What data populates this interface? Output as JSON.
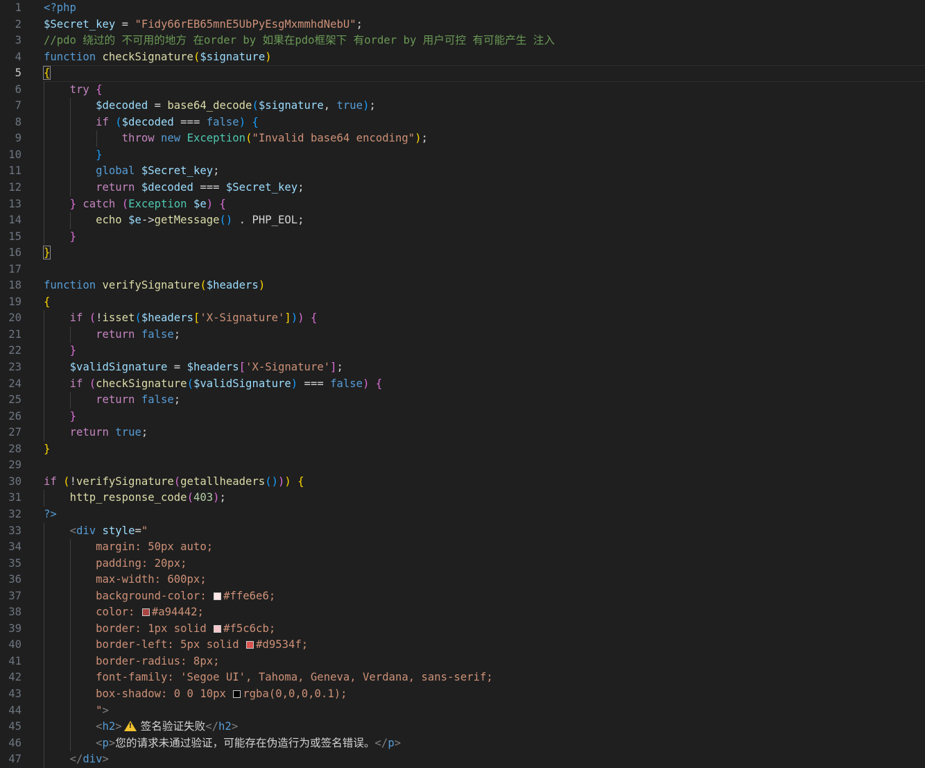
{
  "colors": {
    "background": "#1f1f1f",
    "line_number": "#6e7681",
    "keyword": "#569cd6",
    "control": "#c586c0",
    "function": "#dcdcaa",
    "variable": "#9cdcfe",
    "string": "#ce9178",
    "comment": "#6a9955",
    "number": "#b5cea8",
    "class": "#4ec9b0",
    "tag": "#808080"
  },
  "current_line": 5,
  "lines": [
    {
      "n": 1,
      "indent": 0,
      "tokens": [
        {
          "t": "<?php",
          "c": "#569cd6"
        }
      ]
    },
    {
      "n": 2,
      "indent": 0,
      "tokens": [
        {
          "t": "$Secret_key",
          "c": "#9cdcfe"
        },
        {
          "t": " = ",
          "c": "#d4d4d4"
        },
        {
          "t": "\"Fidy66rEB65mnE5UbPyEsgMxmmhdNebU\"",
          "c": "#ce9178"
        },
        {
          "t": ";",
          "c": "#d4d4d4"
        }
      ]
    },
    {
      "n": 3,
      "indent": 0,
      "tokens": [
        {
          "t": "//pdo 绕过的 不可用的地方 在order by 如果在pdo框架下 有order by 用户可控 有可能产生 注入",
          "c": "#6a9955"
        }
      ]
    },
    {
      "n": 4,
      "indent": 0,
      "tokens": [
        {
          "t": "function",
          "c": "#569cd6"
        },
        {
          "t": " ",
          "c": "#d4d4d4"
        },
        {
          "t": "checkSignature",
          "c": "#dcdcaa"
        },
        {
          "t": "(",
          "c": "#ffd700"
        },
        {
          "t": "$signature",
          "c": "#9cdcfe"
        },
        {
          "t": ")",
          "c": "#ffd700"
        }
      ]
    },
    {
      "n": 5,
      "indent": 0,
      "tokens": [
        {
          "t": "{",
          "c": "#ffd700",
          "bm": true
        }
      ]
    },
    {
      "n": 6,
      "indent": 1,
      "tokens": [
        {
          "t": "    ",
          "c": "#d4d4d4"
        },
        {
          "t": "try",
          "c": "#c586c0"
        },
        {
          "t": " ",
          "c": "#d4d4d4"
        },
        {
          "t": "{",
          "c": "#da70d6"
        }
      ]
    },
    {
      "n": 7,
      "indent": 2,
      "tokens": [
        {
          "t": "        ",
          "c": "#d4d4d4"
        },
        {
          "t": "$decoded",
          "c": "#9cdcfe"
        },
        {
          "t": " = ",
          "c": "#d4d4d4"
        },
        {
          "t": "base64_decode",
          "c": "#dcdcaa"
        },
        {
          "t": "(",
          "c": "#179fff"
        },
        {
          "t": "$signature",
          "c": "#9cdcfe"
        },
        {
          "t": ", ",
          "c": "#d4d4d4"
        },
        {
          "t": "true",
          "c": "#569cd6"
        },
        {
          "t": ")",
          "c": "#179fff"
        },
        {
          "t": ";",
          "c": "#d4d4d4"
        }
      ]
    },
    {
      "n": 8,
      "indent": 2,
      "tokens": [
        {
          "t": "        ",
          "c": "#d4d4d4"
        },
        {
          "t": "if",
          "c": "#c586c0"
        },
        {
          "t": " ",
          "c": "#d4d4d4"
        },
        {
          "t": "(",
          "c": "#179fff"
        },
        {
          "t": "$decoded",
          "c": "#9cdcfe"
        },
        {
          "t": " === ",
          "c": "#d4d4d4"
        },
        {
          "t": "false",
          "c": "#569cd6"
        },
        {
          "t": ")",
          "c": "#179fff"
        },
        {
          "t": " ",
          "c": "#d4d4d4"
        },
        {
          "t": "{",
          "c": "#179fff"
        }
      ]
    },
    {
      "n": 9,
      "indent": 3,
      "tokens": [
        {
          "t": "            ",
          "c": "#d4d4d4"
        },
        {
          "t": "throw",
          "c": "#c586c0"
        },
        {
          "t": " ",
          "c": "#d4d4d4"
        },
        {
          "t": "new",
          "c": "#569cd6"
        },
        {
          "t": " ",
          "c": "#d4d4d4"
        },
        {
          "t": "Exception",
          "c": "#4ec9b0"
        },
        {
          "t": "(",
          "c": "#ffd700"
        },
        {
          "t": "\"Invalid base64 encoding\"",
          "c": "#ce9178"
        },
        {
          "t": ")",
          "c": "#ffd700"
        },
        {
          "t": ";",
          "c": "#d4d4d4"
        }
      ]
    },
    {
      "n": 10,
      "indent": 2,
      "tokens": [
        {
          "t": "        ",
          "c": "#d4d4d4"
        },
        {
          "t": "}",
          "c": "#179fff"
        }
      ]
    },
    {
      "n": 11,
      "indent": 2,
      "tokens": [
        {
          "t": "        ",
          "c": "#d4d4d4"
        },
        {
          "t": "global",
          "c": "#569cd6"
        },
        {
          "t": " ",
          "c": "#d4d4d4"
        },
        {
          "t": "$Secret_key",
          "c": "#9cdcfe"
        },
        {
          "t": ";",
          "c": "#d4d4d4"
        }
      ]
    },
    {
      "n": 12,
      "indent": 2,
      "tokens": [
        {
          "t": "        ",
          "c": "#d4d4d4"
        },
        {
          "t": "return",
          "c": "#c586c0"
        },
        {
          "t": " ",
          "c": "#d4d4d4"
        },
        {
          "t": "$decoded",
          "c": "#9cdcfe"
        },
        {
          "t": " === ",
          "c": "#d4d4d4"
        },
        {
          "t": "$Secret_key",
          "c": "#9cdcfe"
        },
        {
          "t": ";",
          "c": "#d4d4d4"
        }
      ]
    },
    {
      "n": 13,
      "indent": 1,
      "tokens": [
        {
          "t": "    ",
          "c": "#d4d4d4"
        },
        {
          "t": "}",
          "c": "#da70d6"
        },
        {
          "t": " ",
          "c": "#d4d4d4"
        },
        {
          "t": "catch",
          "c": "#c586c0"
        },
        {
          "t": " ",
          "c": "#d4d4d4"
        },
        {
          "t": "(",
          "c": "#da70d6"
        },
        {
          "t": "Exception",
          "c": "#4ec9b0"
        },
        {
          "t": " ",
          "c": "#d4d4d4"
        },
        {
          "t": "$e",
          "c": "#9cdcfe"
        },
        {
          "t": ")",
          "c": "#da70d6"
        },
        {
          "t": " ",
          "c": "#d4d4d4"
        },
        {
          "t": "{",
          "c": "#da70d6"
        }
      ]
    },
    {
      "n": 14,
      "indent": 2,
      "tokens": [
        {
          "t": "        ",
          "c": "#d4d4d4"
        },
        {
          "t": "echo",
          "c": "#dcdcaa"
        },
        {
          "t": " ",
          "c": "#d4d4d4"
        },
        {
          "t": "$e",
          "c": "#9cdcfe"
        },
        {
          "t": "->",
          "c": "#d4d4d4"
        },
        {
          "t": "getMessage",
          "c": "#dcdcaa"
        },
        {
          "t": "()",
          "c": "#179fff"
        },
        {
          "t": " . PHP_EOL;",
          "c": "#d4d4d4"
        }
      ]
    },
    {
      "n": 15,
      "indent": 1,
      "tokens": [
        {
          "t": "    ",
          "c": "#d4d4d4"
        },
        {
          "t": "}",
          "c": "#da70d6"
        }
      ]
    },
    {
      "n": 16,
      "indent": 0,
      "tokens": [
        {
          "t": "}",
          "c": "#ffd700",
          "bm": true
        }
      ]
    },
    {
      "n": 17,
      "indent": 0,
      "tokens": []
    },
    {
      "n": 18,
      "indent": 0,
      "tokens": [
        {
          "t": "function",
          "c": "#569cd6"
        },
        {
          "t": " ",
          "c": "#d4d4d4"
        },
        {
          "t": "verifySignature",
          "c": "#dcdcaa"
        },
        {
          "t": "(",
          "c": "#ffd700"
        },
        {
          "t": "$headers",
          "c": "#9cdcfe"
        },
        {
          "t": ")",
          "c": "#ffd700"
        }
      ]
    },
    {
      "n": 19,
      "indent": 0,
      "tokens": [
        {
          "t": "{",
          "c": "#ffd700"
        }
      ]
    },
    {
      "n": 20,
      "indent": 1,
      "tokens": [
        {
          "t": "    ",
          "c": "#d4d4d4"
        },
        {
          "t": "if",
          "c": "#c586c0"
        },
        {
          "t": " ",
          "c": "#d4d4d4"
        },
        {
          "t": "(",
          "c": "#da70d6"
        },
        {
          "t": "!",
          "c": "#d4d4d4"
        },
        {
          "t": "isset",
          "c": "#dcdcaa"
        },
        {
          "t": "(",
          "c": "#179fff"
        },
        {
          "t": "$headers",
          "c": "#9cdcfe"
        },
        {
          "t": "[",
          "c": "#ffd700"
        },
        {
          "t": "'X-Signature'",
          "c": "#ce9178"
        },
        {
          "t": "]",
          "c": "#ffd700"
        },
        {
          "t": ")",
          "c": "#179fff"
        },
        {
          "t": ")",
          "c": "#da70d6"
        },
        {
          "t": " ",
          "c": "#d4d4d4"
        },
        {
          "t": "{",
          "c": "#da70d6"
        }
      ]
    },
    {
      "n": 21,
      "indent": 2,
      "tokens": [
        {
          "t": "        ",
          "c": "#d4d4d4"
        },
        {
          "t": "return",
          "c": "#c586c0"
        },
        {
          "t": " ",
          "c": "#d4d4d4"
        },
        {
          "t": "false",
          "c": "#569cd6"
        },
        {
          "t": ";",
          "c": "#d4d4d4"
        }
      ]
    },
    {
      "n": 22,
      "indent": 1,
      "tokens": [
        {
          "t": "    ",
          "c": "#d4d4d4"
        },
        {
          "t": "}",
          "c": "#da70d6"
        }
      ]
    },
    {
      "n": 23,
      "indent": 1,
      "tokens": [
        {
          "t": "    ",
          "c": "#d4d4d4"
        },
        {
          "t": "$validSignature",
          "c": "#9cdcfe"
        },
        {
          "t": " = ",
          "c": "#d4d4d4"
        },
        {
          "t": "$headers",
          "c": "#9cdcfe"
        },
        {
          "t": "[",
          "c": "#da70d6"
        },
        {
          "t": "'X-Signature'",
          "c": "#ce9178"
        },
        {
          "t": "]",
          "c": "#da70d6"
        },
        {
          "t": ";",
          "c": "#d4d4d4"
        }
      ]
    },
    {
      "n": 24,
      "indent": 1,
      "tokens": [
        {
          "t": "    ",
          "c": "#d4d4d4"
        },
        {
          "t": "if",
          "c": "#c586c0"
        },
        {
          "t": " ",
          "c": "#d4d4d4"
        },
        {
          "t": "(",
          "c": "#da70d6"
        },
        {
          "t": "checkSignature",
          "c": "#dcdcaa"
        },
        {
          "t": "(",
          "c": "#179fff"
        },
        {
          "t": "$validSignature",
          "c": "#9cdcfe"
        },
        {
          "t": ")",
          "c": "#179fff"
        },
        {
          "t": " === ",
          "c": "#d4d4d4"
        },
        {
          "t": "false",
          "c": "#569cd6"
        },
        {
          "t": ")",
          "c": "#da70d6"
        },
        {
          "t": " ",
          "c": "#d4d4d4"
        },
        {
          "t": "{",
          "c": "#da70d6"
        }
      ]
    },
    {
      "n": 25,
      "indent": 2,
      "tokens": [
        {
          "t": "        ",
          "c": "#d4d4d4"
        },
        {
          "t": "return",
          "c": "#c586c0"
        },
        {
          "t": " ",
          "c": "#d4d4d4"
        },
        {
          "t": "false",
          "c": "#569cd6"
        },
        {
          "t": ";",
          "c": "#d4d4d4"
        }
      ]
    },
    {
      "n": 26,
      "indent": 1,
      "tokens": [
        {
          "t": "    ",
          "c": "#d4d4d4"
        },
        {
          "t": "}",
          "c": "#da70d6"
        }
      ]
    },
    {
      "n": 27,
      "indent": 1,
      "tokens": [
        {
          "t": "    ",
          "c": "#d4d4d4"
        },
        {
          "t": "return",
          "c": "#c586c0"
        },
        {
          "t": " ",
          "c": "#d4d4d4"
        },
        {
          "t": "true",
          "c": "#569cd6"
        },
        {
          "t": ";",
          "c": "#d4d4d4"
        }
      ]
    },
    {
      "n": 28,
      "indent": 0,
      "tokens": [
        {
          "t": "}",
          "c": "#ffd700"
        }
      ]
    },
    {
      "n": 29,
      "indent": 0,
      "tokens": []
    },
    {
      "n": 30,
      "indent": 0,
      "tokens": [
        {
          "t": "if",
          "c": "#c586c0"
        },
        {
          "t": " ",
          "c": "#d4d4d4"
        },
        {
          "t": "(",
          "c": "#ffd700"
        },
        {
          "t": "!",
          "c": "#d4d4d4"
        },
        {
          "t": "verifySignature",
          "c": "#dcdcaa"
        },
        {
          "t": "(",
          "c": "#da70d6"
        },
        {
          "t": "getallheaders",
          "c": "#dcdcaa"
        },
        {
          "t": "()",
          "c": "#179fff"
        },
        {
          "t": ")",
          "c": "#da70d6"
        },
        {
          "t": ")",
          "c": "#ffd700"
        },
        {
          "t": " ",
          "c": "#d4d4d4"
        },
        {
          "t": "{",
          "c": "#ffd700"
        }
      ]
    },
    {
      "n": 31,
      "indent": 1,
      "tokens": [
        {
          "t": "    ",
          "c": "#d4d4d4"
        },
        {
          "t": "http_response_code",
          "c": "#dcdcaa"
        },
        {
          "t": "(",
          "c": "#da70d6"
        },
        {
          "t": "403",
          "c": "#b5cea8"
        },
        {
          "t": ")",
          "c": "#da70d6"
        },
        {
          "t": ";",
          "c": "#d4d4d4"
        }
      ]
    },
    {
      "n": 32,
      "indent": 0,
      "tokens": [
        {
          "t": "?>",
          "c": "#569cd6"
        }
      ]
    },
    {
      "n": 33,
      "indent": 1,
      "tokens": [
        {
          "t": "    ",
          "c": "#d4d4d4"
        },
        {
          "t": "<",
          "c": "#808080"
        },
        {
          "t": "div",
          "c": "#569cd6"
        },
        {
          "t": " ",
          "c": "#d4d4d4"
        },
        {
          "t": "style",
          "c": "#9cdcfe"
        },
        {
          "t": "=",
          "c": "#d4d4d4"
        },
        {
          "t": "\"",
          "c": "#ce9178"
        }
      ]
    },
    {
      "n": 34,
      "indent": 2,
      "tokens": [
        {
          "t": "        ",
          "c": "#d4d4d4"
        },
        {
          "t": "margin: 50px auto;",
          "c": "#ce9178"
        }
      ]
    },
    {
      "n": 35,
      "indent": 2,
      "tokens": [
        {
          "t": "        ",
          "c": "#d4d4d4"
        },
        {
          "t": "padding: 20px;",
          "c": "#ce9178"
        }
      ]
    },
    {
      "n": 36,
      "indent": 2,
      "tokens": [
        {
          "t": "        ",
          "c": "#d4d4d4"
        },
        {
          "t": "max-width: 600px;",
          "c": "#ce9178"
        }
      ]
    },
    {
      "n": 37,
      "indent": 2,
      "tokens": [
        {
          "t": "        ",
          "c": "#d4d4d4"
        },
        {
          "t": "background-color: ",
          "c": "#ce9178"
        },
        {
          "sw": "#ffe6e6"
        },
        {
          "t": "#ffe6e6;",
          "c": "#ce9178"
        }
      ]
    },
    {
      "n": 38,
      "indent": 2,
      "tokens": [
        {
          "t": "        ",
          "c": "#d4d4d4"
        },
        {
          "t": "color: ",
          "c": "#ce9178"
        },
        {
          "sw": "#a94442"
        },
        {
          "t": "#a94442;",
          "c": "#ce9178"
        }
      ]
    },
    {
      "n": 39,
      "indent": 2,
      "tokens": [
        {
          "t": "        ",
          "c": "#d4d4d4"
        },
        {
          "t": "border: 1px solid ",
          "c": "#ce9178"
        },
        {
          "sw": "#f5c6cb"
        },
        {
          "t": "#f5c6cb;",
          "c": "#ce9178"
        }
      ]
    },
    {
      "n": 40,
      "indent": 2,
      "tokens": [
        {
          "t": "        ",
          "c": "#d4d4d4"
        },
        {
          "t": "border-left: 5px solid ",
          "c": "#ce9178"
        },
        {
          "sw": "#d9534f"
        },
        {
          "t": "#d9534f;",
          "c": "#ce9178"
        }
      ]
    },
    {
      "n": 41,
      "indent": 2,
      "tokens": [
        {
          "t": "        ",
          "c": "#d4d4d4"
        },
        {
          "t": "border-radius: 8px;",
          "c": "#ce9178"
        }
      ]
    },
    {
      "n": 42,
      "indent": 2,
      "tokens": [
        {
          "t": "        ",
          "c": "#d4d4d4"
        },
        {
          "t": "font-family: 'Segoe UI', Tahoma, Geneva, Verdana, sans-serif;",
          "c": "#ce9178"
        }
      ]
    },
    {
      "n": 43,
      "indent": 2,
      "tokens": [
        {
          "t": "        ",
          "c": "#d4d4d4"
        },
        {
          "t": "box-shadow: 0 0 10px ",
          "c": "#ce9178"
        },
        {
          "sw": "#000000"
        },
        {
          "t": "rgba(0,0,0,0.1);",
          "c": "#ce9178"
        }
      ]
    },
    {
      "n": 44,
      "indent": 2,
      "tokens": [
        {
          "t": "        ",
          "c": "#d4d4d4"
        },
        {
          "t": "\"",
          "c": "#ce9178"
        },
        {
          "t": ">",
          "c": "#808080"
        }
      ]
    },
    {
      "n": 45,
      "indent": 2,
      "tokens": [
        {
          "t": "        ",
          "c": "#d4d4d4"
        },
        {
          "t": "<",
          "c": "#808080"
        },
        {
          "t": "h2",
          "c": "#569cd6"
        },
        {
          "t": ">",
          "c": "#808080"
        },
        {
          "warn": true
        },
        {
          "t": "签名验证失败",
          "c": "#d4d4d4"
        },
        {
          "t": "</",
          "c": "#808080"
        },
        {
          "t": "h2",
          "c": "#569cd6"
        },
        {
          "t": ">",
          "c": "#808080"
        }
      ]
    },
    {
      "n": 46,
      "indent": 2,
      "tokens": [
        {
          "t": "        ",
          "c": "#d4d4d4"
        },
        {
          "t": "<",
          "c": "#808080"
        },
        {
          "t": "p",
          "c": "#569cd6"
        },
        {
          "t": ">",
          "c": "#808080"
        },
        {
          "t": "您的请求未通过验证，可能存在伪造行为或签名错误。",
          "c": "#d4d4d4"
        },
        {
          "t": "</",
          "c": "#808080"
        },
        {
          "t": "p",
          "c": "#569cd6"
        },
        {
          "t": ">",
          "c": "#808080"
        }
      ]
    },
    {
      "n": 47,
      "indent": 1,
      "tokens": [
        {
          "t": "    ",
          "c": "#d4d4d4"
        },
        {
          "t": "</",
          "c": "#808080"
        },
        {
          "t": "div",
          "c": "#569cd6"
        },
        {
          "t": ">",
          "c": "#808080"
        }
      ]
    }
  ]
}
